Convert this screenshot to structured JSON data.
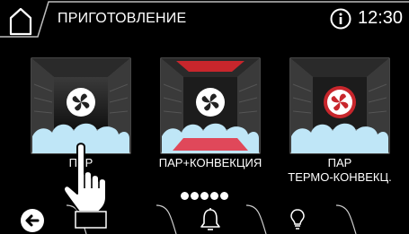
{
  "header": {
    "title": "ПРИГОТОВЛЕНИЕ",
    "time": "12:30"
  },
  "modes": [
    {
      "label": "ПАР",
      "top_heater_active": false,
      "bottom_heater_active": false,
      "fan_active": false
    },
    {
      "label": "ПАР+КОНВЕКЦИЯ",
      "top_heater_active": true,
      "bottom_heater_active": true,
      "fan_active": false
    },
    {
      "label": "ПАР\nТЕРМО-КОНВЕКЦ.",
      "top_heater_active": false,
      "bottom_heater_active": false,
      "fan_active": true
    }
  ],
  "pager": {
    "total": 5
  },
  "icons": {
    "home": "home-icon",
    "info": "info-icon",
    "back": "back-arrow-icon",
    "bell": "bell-icon",
    "bulb": "lightbulb-icon",
    "hand": "pointing-hand-icon"
  },
  "colors": {
    "accent_red": "#c8262c",
    "steam": "#bfe6f7",
    "cavity_dark": "#1c1c1c",
    "cavity_frame": "#6e6e6e"
  }
}
